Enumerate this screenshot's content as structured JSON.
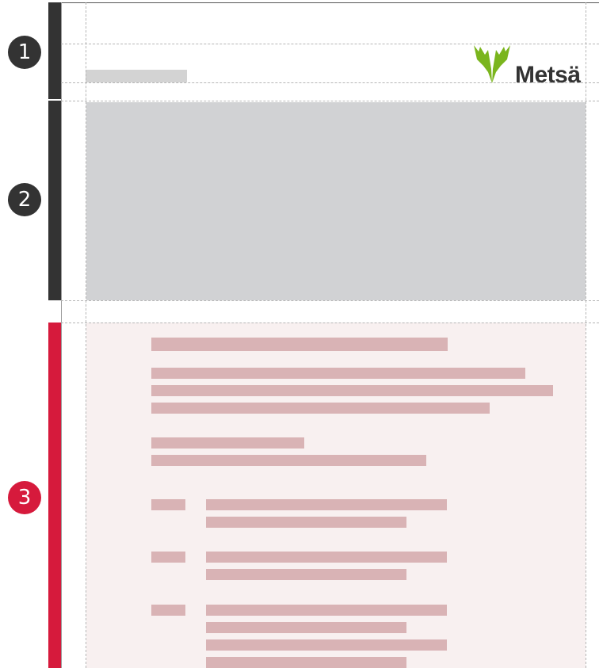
{
  "sections": [
    {
      "number": "1",
      "color": "#333333"
    },
    {
      "number": "2",
      "color": "#333333"
    },
    {
      "number": "3",
      "color": "#d61a3c"
    }
  ],
  "logo": {
    "text": "Metsä",
    "text_color": "#333333",
    "icon": "moose-antlers-icon",
    "icon_color": "#7ab51d"
  },
  "colors": {
    "header_placeholder": "#d3d3d3",
    "hero_placeholder": "#d1d2d4",
    "body_background": "#f8f0f0",
    "text_placeholder": "#d9b3b5",
    "guide": "#b5b5b5"
  }
}
